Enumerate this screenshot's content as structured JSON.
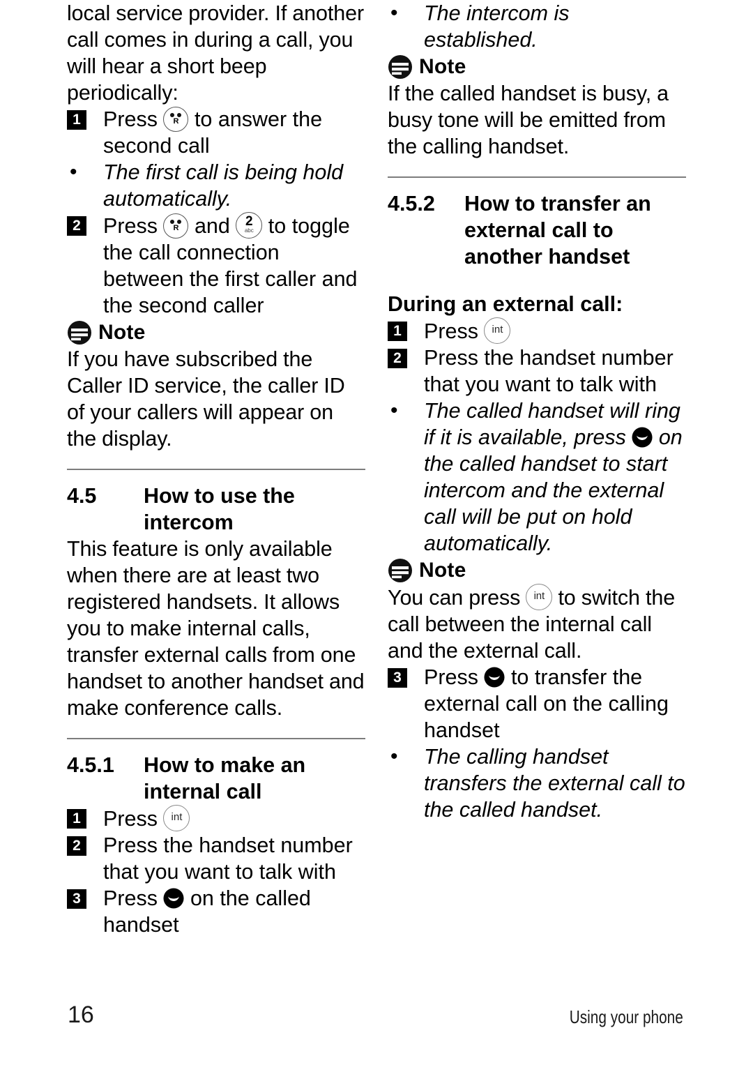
{
  "page": {
    "number": "16",
    "footer_title": "Using your phone"
  },
  "icons": {
    "recall_key": "recall-r-key-icon",
    "two_key_digit": "2",
    "two_key_letters": "abc",
    "int_key": "int",
    "talk_key": "talk-key-icon",
    "note_icon": "note-icon",
    "bullet": "•"
  },
  "left_column": {
    "intro_paragraph": "local service provider. If another call comes in during a call, you will hear a short beep periodically:",
    "step1": {
      "num": "1",
      "text_before": "Press",
      "text_after": "to answer the second call"
    },
    "bullet1": "The first call is being hold automatically.",
    "step2": {
      "num": "2",
      "text_before": "Press",
      "text_middle": "and",
      "text_after": "to toggle the call connection between the first caller and the second caller"
    },
    "note1": {
      "label": "Note",
      "body": "If you have subscribed the Caller ID service, the caller ID of your callers will appear on the display."
    },
    "section_4_5": {
      "number": "4.5",
      "title": "How to use the intercom",
      "body": "This feature is only available when there are at least two registered handsets.  It allows you to make internal calls, transfer external calls from one handset to another handset and make conference calls."
    },
    "section_4_5_1": {
      "number": "4.5.1",
      "title": "How to make an internal call",
      "step1": {
        "num": "1",
        "text_before": "Press",
        "text_after": ""
      },
      "step2": {
        "num": "2",
        "text": "Press the handset number that you want to talk with"
      },
      "step3": {
        "num": "3",
        "text_before": "Press",
        "text_after": "on the called handset"
      }
    }
  },
  "right_column": {
    "bullet1": "The intercom is established.",
    "note1": {
      "label": "Note",
      "body": "If the called handset is busy, a busy tone will be emitted from the calling handset."
    },
    "section_4_5_2": {
      "number": "4.5.2",
      "title": "How to transfer an external call to another handset",
      "subheading": "During an external call:",
      "step1": {
        "num": "1",
        "text_before": "Press",
        "text_after": ""
      },
      "step2": {
        "num": "2",
        "text": "Press the handset number that you want to talk with"
      },
      "bullet1_part1": "The called handset will ring if it is available, press",
      "bullet1_part2": "on the called handset to start intercom and the external call will be put on hold automatically.",
      "note2": {
        "label": "Note",
        "body_before": "You can press",
        "body_after": "to switch the call between the internal call and the external call."
      },
      "step3": {
        "num": "3",
        "text_before": "Press",
        "text_after": "to transfer the external call on the calling handset"
      },
      "bullet2": "The calling handset transfers the external call to the called handset."
    }
  }
}
